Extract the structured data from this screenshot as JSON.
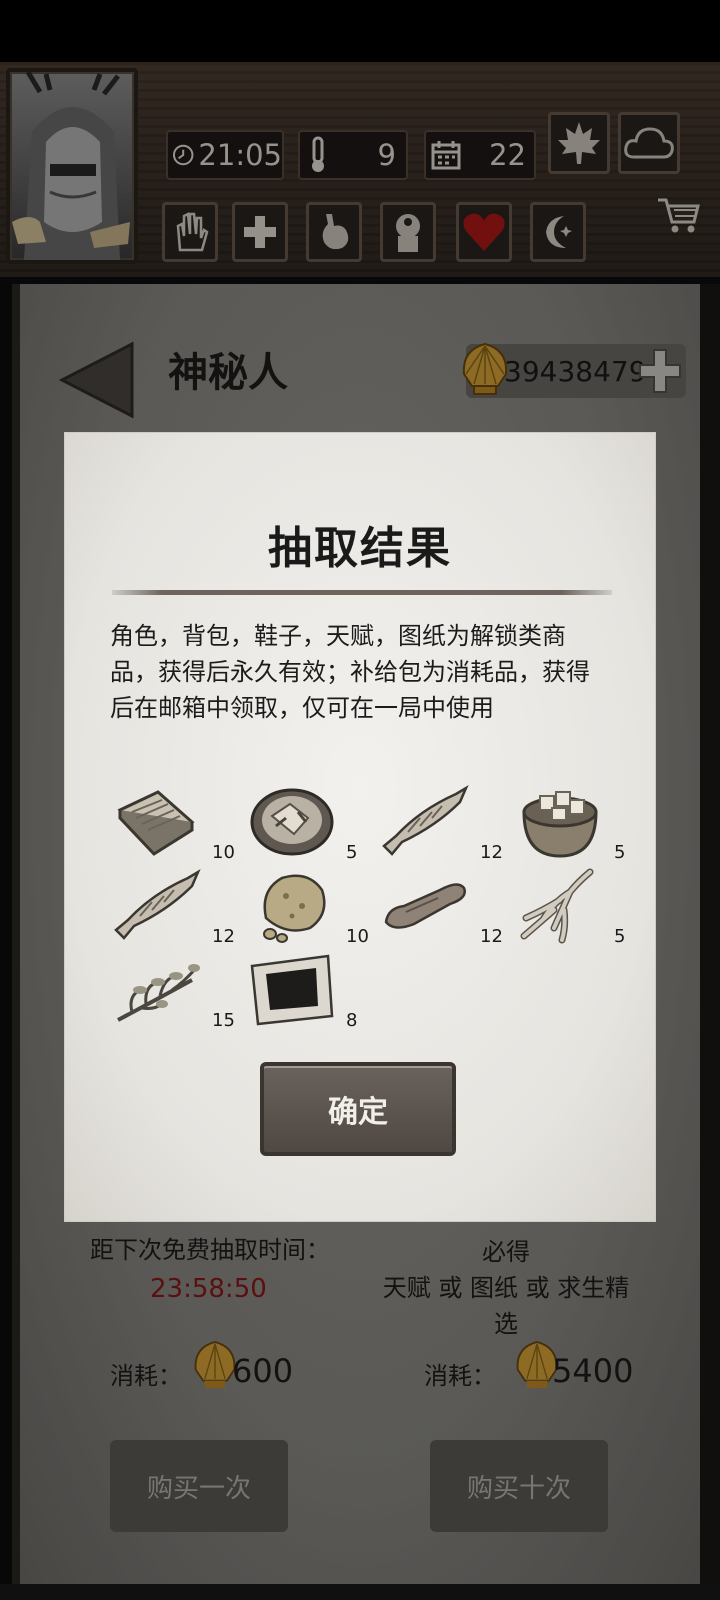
{
  "hud": {
    "time": "21:05",
    "temperature": "9",
    "day": "22",
    "clock_icon": "clock-icon",
    "thermometer_icon": "thermometer-icon",
    "calendar_icon": "calendar-icon",
    "leaf_icon": "maple-leaf-icon",
    "weather_icon": "cloud-icon",
    "cart_icon": "shopping-cart-icon",
    "status_icons": [
      "hand-icon",
      "medical-cross-icon",
      "stomach-icon",
      "head-icon",
      "heart-icon",
      "moon-icon"
    ]
  },
  "header": {
    "npc_name": "神秘人",
    "currency_amount": "39438479",
    "currency_icon": "shell-icon",
    "add_icon": "plus-icon",
    "back_icon": "back-arrow-icon"
  },
  "dialog": {
    "title": "抽取结果",
    "description": "角色，背包，鞋子，天赋，图纸为解锁类商品，获得后永久有效；补给包为消耗品，获得后在邮箱中领取，仅可在一局中使用",
    "items": [
      {
        "icon": "book-icon",
        "count": "10"
      },
      {
        "icon": "bowl-of-meat-icon",
        "count": "5"
      },
      {
        "icon": "dried-fish-icon",
        "count": "12"
      },
      {
        "icon": "bowl-of-tofu-icon",
        "count": "5"
      },
      {
        "icon": "dried-fish-icon",
        "count": "12"
      },
      {
        "icon": "ore-rock-icon",
        "count": "10"
      },
      {
        "icon": "meat-strip-icon",
        "count": "12"
      },
      {
        "icon": "ginseng-root-icon",
        "count": "5"
      },
      {
        "icon": "herb-sprig-icon",
        "count": "15"
      },
      {
        "icon": "black-cloth-icon",
        "count": "8"
      }
    ],
    "confirm_label": "确定"
  },
  "shop": {
    "free_draw_label": "距下次免费抽取时间：",
    "timer": "23:58:50",
    "guarantee_line1": "必得",
    "guarantee_line2": "天赋 或 图纸 或 求生精选",
    "cost_label": "消耗：",
    "single_cost": "600",
    "ten_cost": "5400",
    "buy_once": "购买一次",
    "buy_ten": "购买十次"
  },
  "colors": {
    "timer_red": "#8a1a1a",
    "heart_red": "#b01818",
    "shell_gold": "#d9a53a"
  }
}
